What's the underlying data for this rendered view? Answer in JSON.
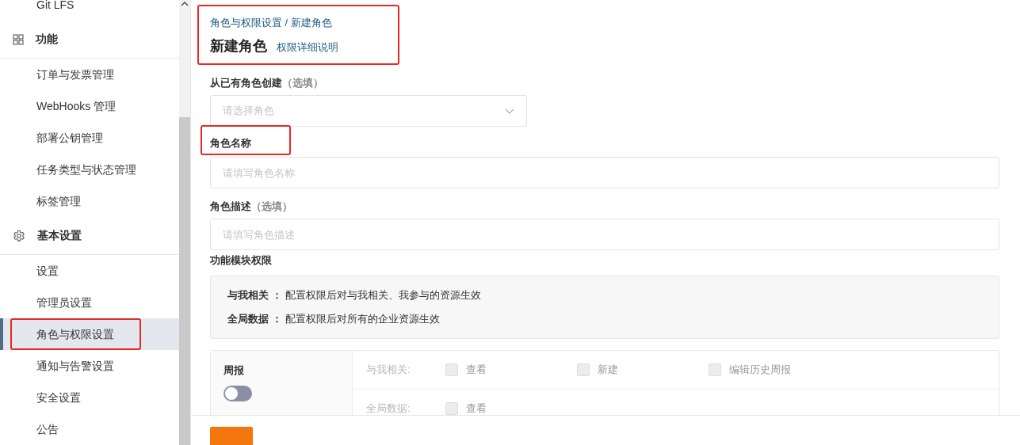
{
  "sidebar": {
    "sections": [
      {
        "items": [
          {
            "label": "Git LFS",
            "selected": false,
            "annotated": false
          }
        ]
      },
      {
        "title": "功能",
        "items": [
          {
            "label": "订单与发票管理",
            "selected": false,
            "annotated": false
          },
          {
            "label": "WebHooks 管理",
            "selected": false,
            "annotated": false
          },
          {
            "label": "部署公钥管理",
            "selected": false,
            "annotated": false
          },
          {
            "label": "任务类型与状态管理",
            "selected": false,
            "annotated": false
          },
          {
            "label": "标签管理",
            "selected": false,
            "annotated": false
          }
        ]
      },
      {
        "title": "基本设置",
        "items": [
          {
            "label": "设置",
            "selected": false,
            "annotated": false
          },
          {
            "label": "管理员设置",
            "selected": false,
            "annotated": false
          },
          {
            "label": "角色与权限设置",
            "selected": true,
            "annotated": true
          },
          {
            "label": "通知与告警设置",
            "selected": false,
            "annotated": false
          },
          {
            "label": "安全设置",
            "selected": false,
            "annotated": false
          },
          {
            "label": "公告",
            "selected": false,
            "annotated": false
          }
        ]
      }
    ]
  },
  "header": {
    "annotated": true,
    "breadcrumb": "角色与权限设置 / 新建角色",
    "title": "新建角色",
    "help_link": "权限详细说明"
  },
  "fields": [
    {
      "kind": "select",
      "label": "从已有角色创建",
      "hint": "（选填）",
      "placeholder": "请选择角色",
      "annotated": false
    },
    {
      "kind": "text",
      "label": "角色名称",
      "placeholder": "请填写角色名称",
      "annotated": true
    },
    {
      "kind": "text",
      "label": "角色描述",
      "hint": "（选填）",
      "placeholder": "请填写角色描述",
      "annotated": false
    }
  ],
  "permissions": {
    "title": "功能模块权限",
    "info": [
      {
        "term": "与我相关 ：",
        "text": "配置权限后对与我相关、我参与的资源生效"
      },
      {
        "term": "全局数据 ：",
        "text": "配置权限后对所有的企业资源生效"
      }
    ],
    "modules": [
      {
        "name": "周报",
        "on": false,
        "rows": [
          {
            "scope": "与我相关:",
            "options": [
              {
                "label": "查看",
                "checked": false,
                "disabled": true
              },
              {
                "label": "新建",
                "checked": false,
                "disabled": true
              },
              {
                "label": "编辑历史周报",
                "checked": false,
                "disabled": true
              }
            ]
          },
          {
            "scope": "全局数据:",
            "options": [
              {
                "label": "查看",
                "checked": false,
                "disabled": true
              }
            ]
          }
        ]
      }
    ]
  },
  "footer": {
    "button": {
      "kind": "primary"
    }
  }
}
